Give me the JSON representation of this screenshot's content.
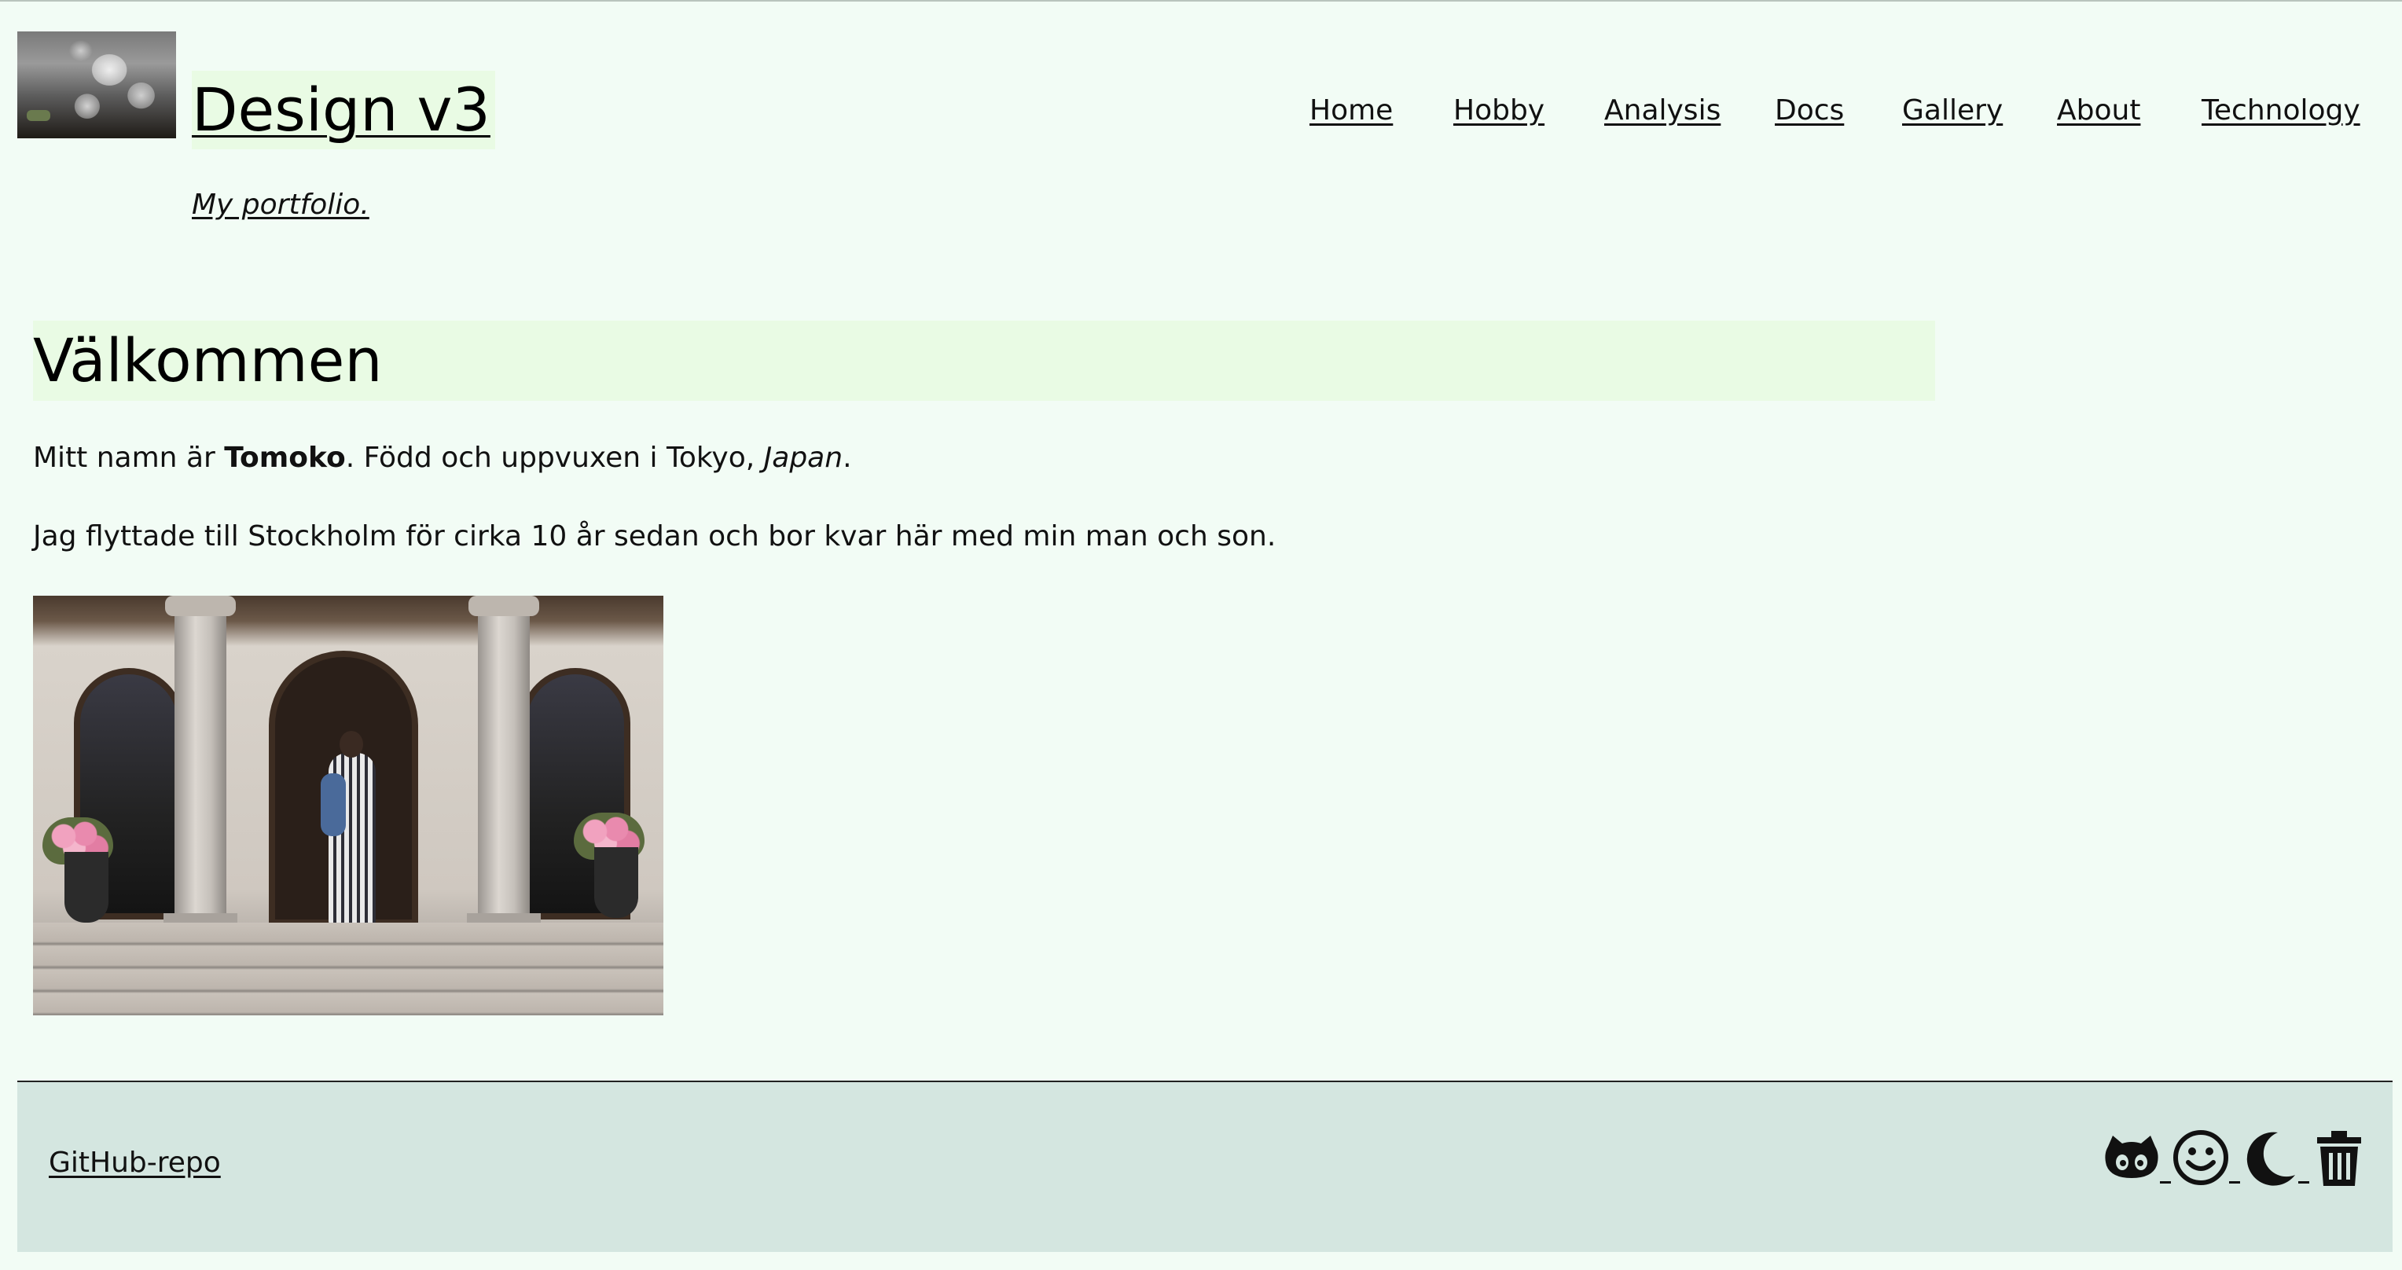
{
  "header": {
    "title": "Design v3",
    "tagline": "My portfolio.",
    "nav": [
      "Home",
      "Hobby",
      "Analysis",
      "Docs",
      "Gallery",
      "About",
      "Technology"
    ]
  },
  "main": {
    "heading": "Välkommen",
    "intro": {
      "prefix": "Mitt namn är ",
      "name": "Tomoko",
      "middle": ". Född och uppvuxen i Tokyo, ",
      "country": "Japan",
      "suffix": "."
    },
    "paragraph2": "Jag flyttade till Stockholm för cirka 10 år sedan och bor kvar här med min man och son."
  },
  "footer": {
    "repo_link": "GitHub-repo",
    "icons": [
      "github-icon",
      "smiley-icon",
      "moon-icon",
      "trash-icon"
    ]
  },
  "colors": {
    "page_bg": "#f2fcf5",
    "heading_bg": "#e9fbe4",
    "footer_bg": "#d4e6e0"
  }
}
